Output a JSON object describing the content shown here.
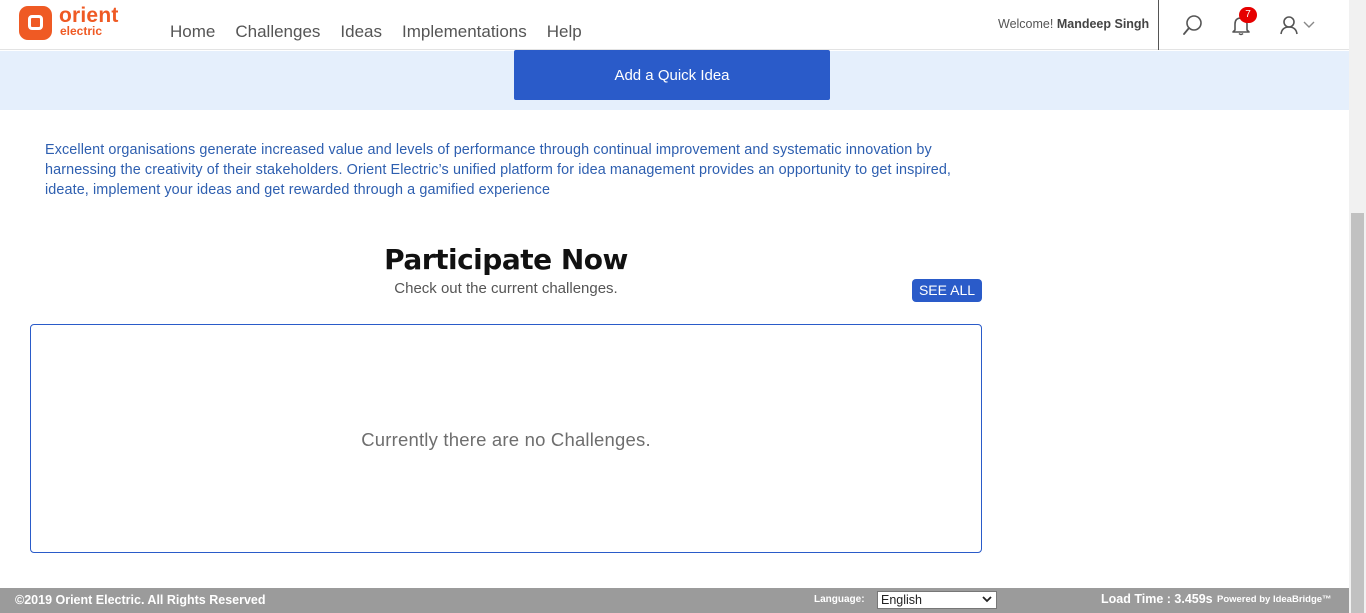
{
  "brand": {
    "word1": "orient",
    "word2": "electric",
    "color": "#ef5a24"
  },
  "nav": {
    "items": [
      "Home",
      "Challenges",
      "Ideas",
      "Implementations",
      "Help"
    ]
  },
  "header": {
    "welcome_prefix": "Welcome!",
    "user_name": "Mandeep Singh",
    "notification_count": "7",
    "icons": [
      "search-icon",
      "bell-icon",
      "user-icon",
      "chevron-down-icon"
    ]
  },
  "banner": {
    "quick_idea_label": "Add a Quick Idea",
    "accent": "#2a5bc9"
  },
  "intro": {
    "text": "Excellent organisations generate increased value and levels of performance through continual improvement and systematic innovation by harnessing the creativity of their stakeholders. Orient Electric’s unified platform for idea management provides an opportunity to get inspired, ideate, implement your ideas and get rewarded through a gamified experience"
  },
  "participate": {
    "title": "Participate Now",
    "subtitle": "Check out the current challenges.",
    "see_all_label": "SEE ALL",
    "empty_message": "Currently there are no Challenges."
  },
  "footer": {
    "copyright": "©2019 Orient Electric. All Rights Reserved",
    "language_label": "Language:",
    "language_value": "English",
    "load_time": "Load Time : 3.459s",
    "powered_by": "Powered by IdeaBridge™"
  }
}
